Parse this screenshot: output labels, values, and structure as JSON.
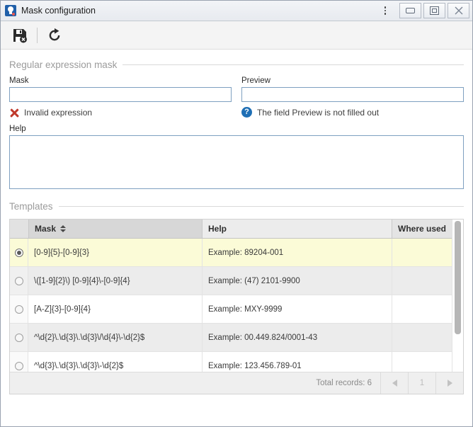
{
  "window": {
    "title": "Mask configuration",
    "app_icon": "app-logo-icon",
    "menu_icon": "kebab-menu-icon",
    "minimize_label": "Minimize",
    "restore_label": "Restore",
    "close_label": "Close"
  },
  "toolbar": {
    "save_icon": "save-disk-icon",
    "save_label": "Save",
    "refresh_icon": "refresh-icon",
    "refresh_label": "Refresh"
  },
  "regex_group": {
    "title": "Regular expression mask",
    "mask": {
      "label": "Mask",
      "value": "",
      "placeholder": ""
    },
    "preview": {
      "label": "Preview",
      "value": "",
      "placeholder": ""
    },
    "mask_message": {
      "icon": "error-x-icon",
      "text": "Invalid expression"
    },
    "preview_message": {
      "icon": "info-question-icon",
      "text": "The field Preview is not filled out"
    },
    "help": {
      "label": "Help",
      "value": "",
      "placeholder": ""
    }
  },
  "templates_group": {
    "title": "Templates",
    "columns": {
      "select": "",
      "mask": "Mask",
      "help": "Help",
      "where_used": "Where used"
    },
    "sort": {
      "column": "Mask",
      "icon": "sort-arrow-icon"
    },
    "rows": [
      {
        "selected": true,
        "mask": "[0-9]{5}-[0-9]{3}",
        "help": "Example: 89204-001",
        "where_used": ""
      },
      {
        "selected": false,
        "mask": "\\([1-9]{2}\\) [0-9]{4}\\-[0-9]{4}",
        "help": "Example: (47) 2101-9900",
        "where_used": ""
      },
      {
        "selected": false,
        "mask": "[A-Z]{3}-[0-9]{4}",
        "help": "Example: MXY-9999",
        "where_used": ""
      },
      {
        "selected": false,
        "mask": "^\\d{2}\\.\\d{3}\\.\\d{3}\\/\\d{4}\\-\\d{2}$",
        "help": "Example: 00.449.824/0001-43",
        "where_used": ""
      },
      {
        "selected": false,
        "mask": "^\\d{3}\\.\\d{3}\\.\\d{3}\\-\\d{2}$",
        "help": "Example: 123.456.789-01",
        "where_used": ""
      }
    ],
    "footer": {
      "total_records": "Total records: 6",
      "prev_icon": "chevron-left-icon",
      "page_number": "1",
      "next_icon": "chevron-right-icon"
    }
  },
  "colors": {
    "selected_row": "#fbfbd7",
    "error": "#c0392b",
    "info": "#1f6fb5",
    "accent": "#1f5fa9",
    "input_border": "#7ea0c0"
  }
}
